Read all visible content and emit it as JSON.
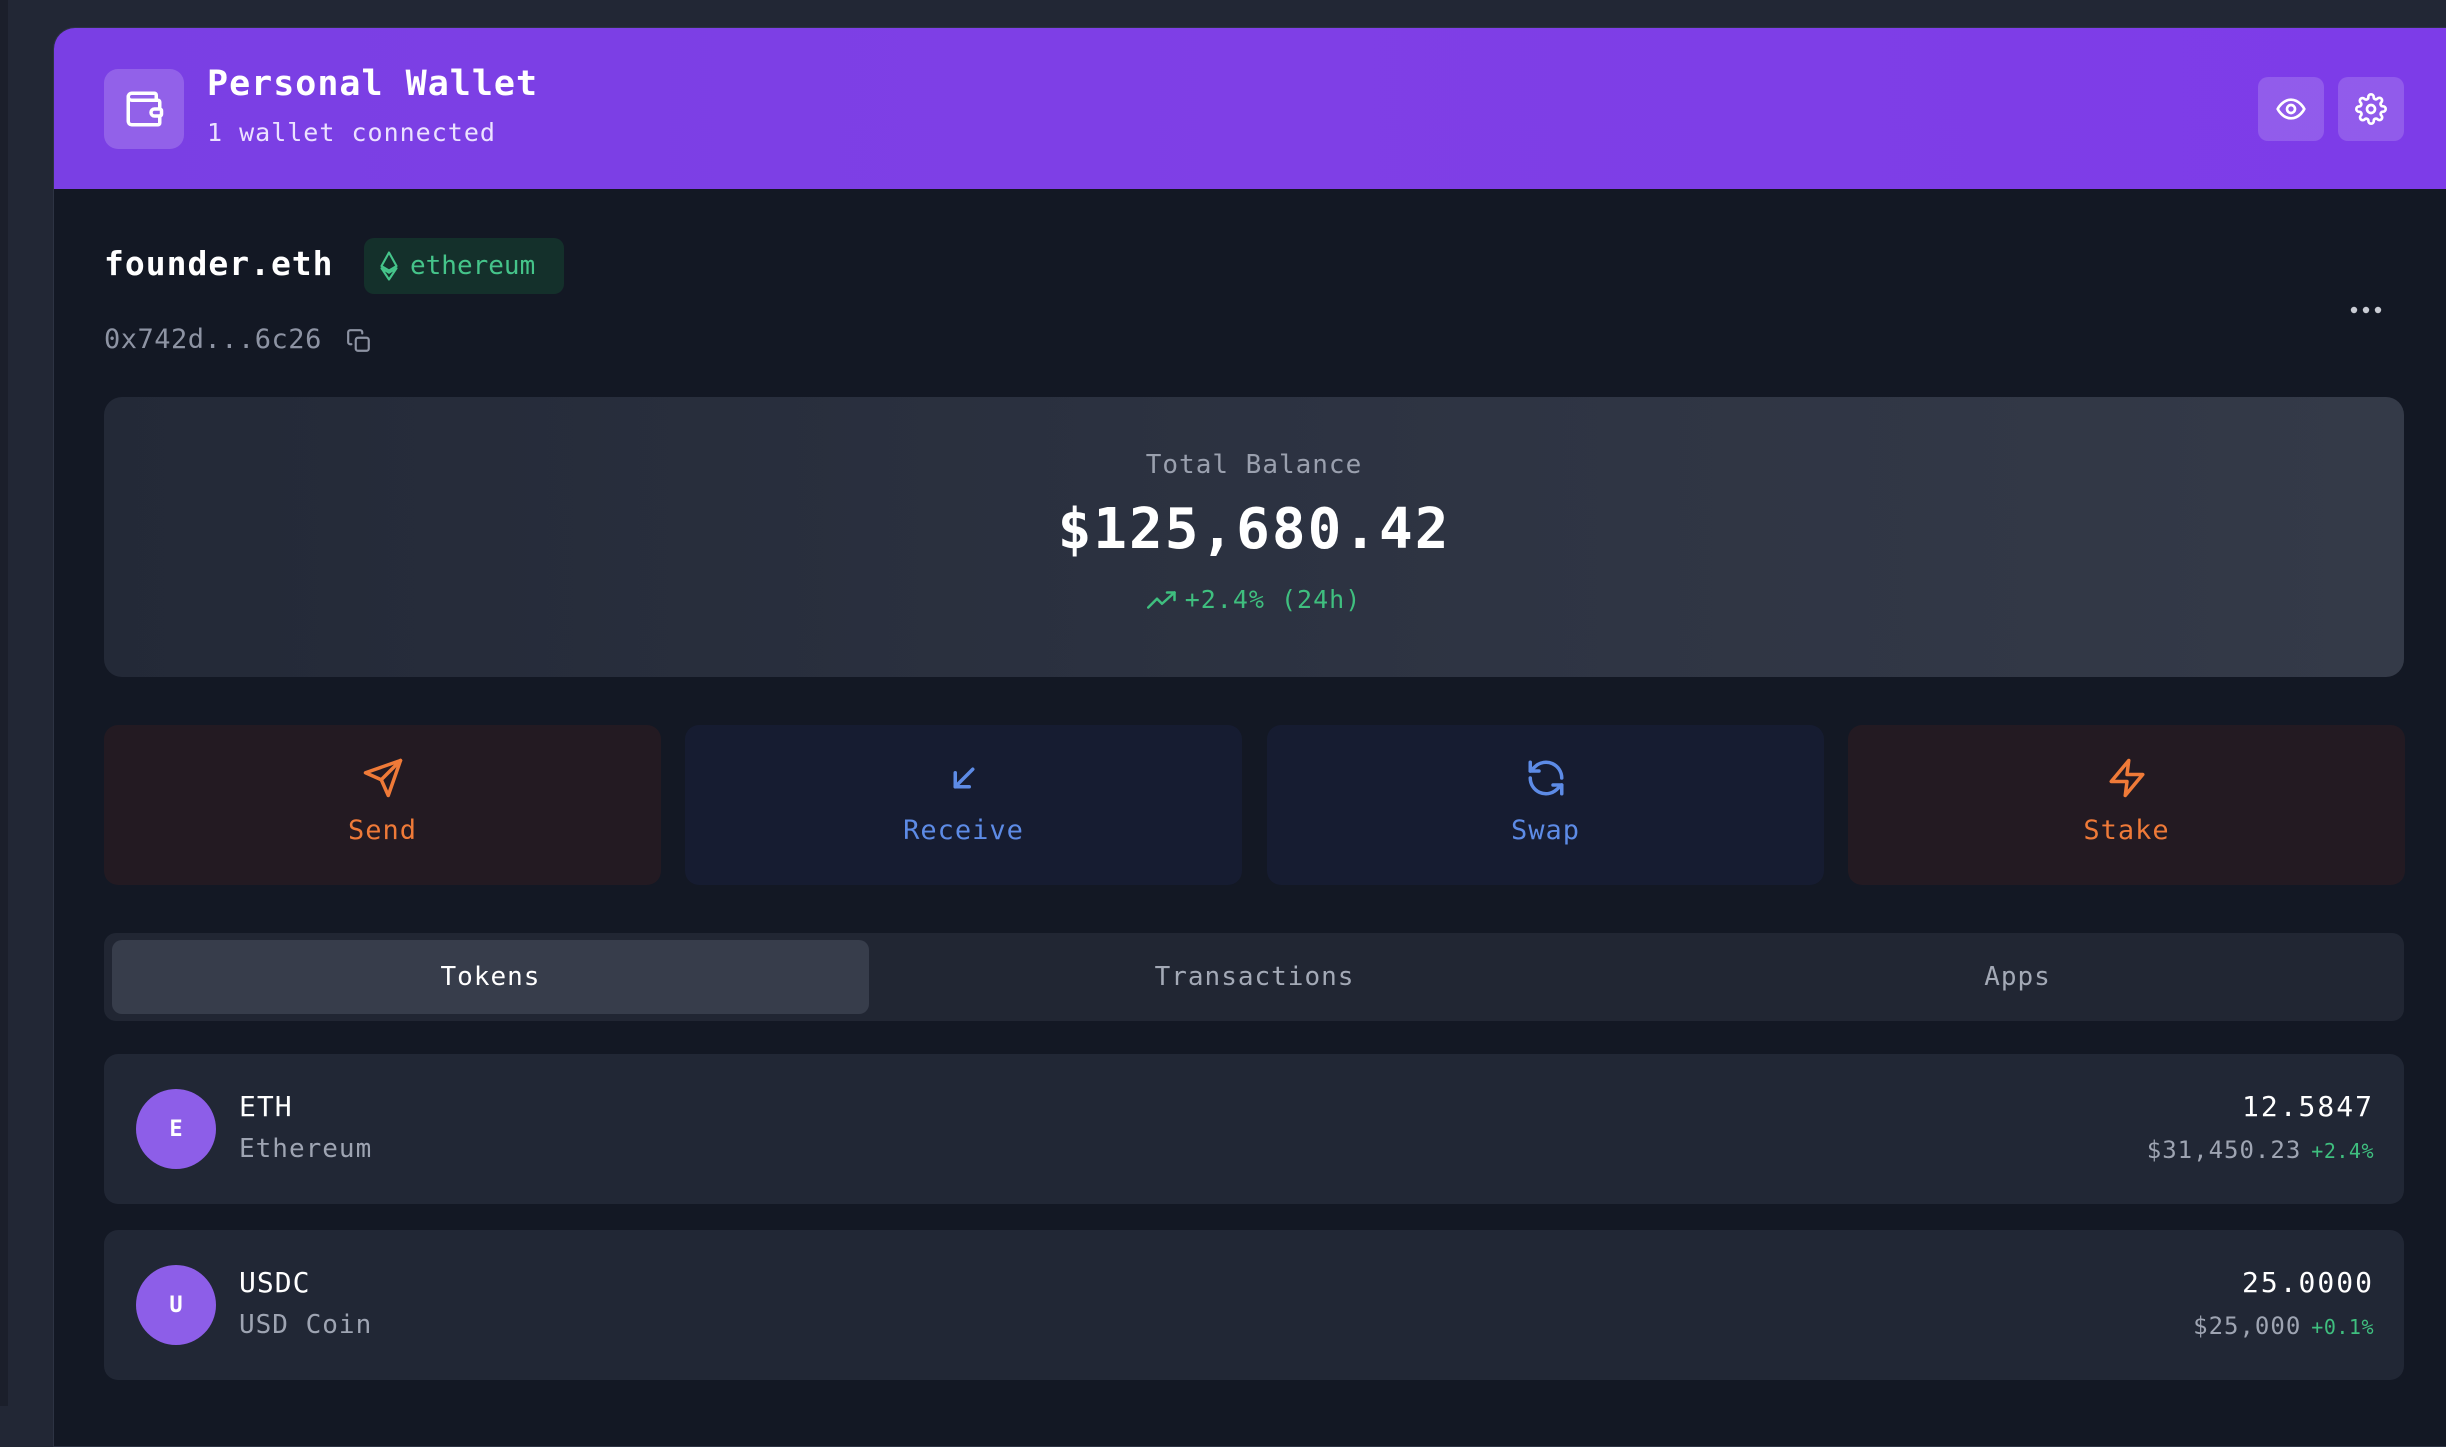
{
  "header": {
    "title": "Personal Wallet",
    "subtitle": "1 wallet connected",
    "icons": [
      "wallet-icon",
      "eye-icon",
      "gear-icon"
    ],
    "accent": "#7c3fe6"
  },
  "account": {
    "name": "founder.eth",
    "chain": "ethereum",
    "address": "0x742d...6c26"
  },
  "balance": {
    "label": "Total Balance",
    "value": "$125,680.42",
    "change": "+2.4% (24h)"
  },
  "actions": [
    {
      "label": "Send",
      "icon": "send-icon"
    },
    {
      "label": "Receive",
      "icon": "receive-icon"
    },
    {
      "label": "Swap",
      "icon": "swap-icon"
    },
    {
      "label": "Stake",
      "icon": "zap-icon"
    }
  ],
  "tabs": [
    {
      "label": "Tokens",
      "active": true
    },
    {
      "label": "Transactions",
      "active": false
    },
    {
      "label": "Apps",
      "active": false
    }
  ],
  "tokens": [
    {
      "initial": "E",
      "symbol": "ETH",
      "name": "Ethereum",
      "amount": "12.5847",
      "usd": "$31,450.23",
      "change": "+2.4%"
    },
    {
      "initial": "U",
      "symbol": "USDC",
      "name": "USD Coin",
      "amount": "25.0000",
      "usd": "$25,000",
      "change": "+0.1%"
    }
  ],
  "colors": {
    "positive": "#3fbf7f",
    "warm_action": "#ef7a38",
    "cool_action": "#5d8be6",
    "token_avatar": "#8d5ee8"
  }
}
